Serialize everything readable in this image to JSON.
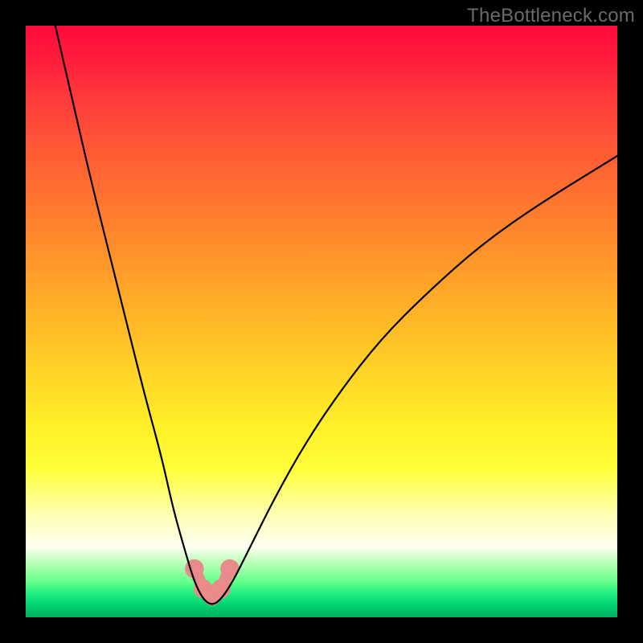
{
  "watermark": "TheBottleneck.com",
  "chart_data": {
    "type": "line",
    "title": "",
    "xlabel": "",
    "ylabel": "",
    "xlim": [
      0,
      100
    ],
    "ylim": [
      0,
      100
    ],
    "series": [
      {
        "name": "bottleneck-curve",
        "x": [
          5,
          8,
          11,
          14,
          17,
          20,
          23,
          25,
          27,
          28.5,
          30,
          31.5,
          33,
          35,
          38,
          42,
          47,
          53,
          60,
          68,
          77,
          87,
          100
        ],
        "values": [
          100,
          87,
          74,
          62,
          50,
          38,
          27,
          18,
          11,
          6,
          3,
          2,
          3,
          6,
          12,
          20,
          29,
          38,
          47,
          55,
          63,
          70,
          78
        ]
      }
    ],
    "markers": [
      {
        "name": "left-elbow",
        "cx": 28.5,
        "cy": 8.2,
        "r": 1.6
      },
      {
        "name": "bottom-left",
        "cx": 30.0,
        "cy": 4.8,
        "r": 1.6
      },
      {
        "name": "bottom-center",
        "cx": 31.5,
        "cy": 3.6,
        "r": 1.6
      },
      {
        "name": "bottom-right",
        "cx": 33.0,
        "cy": 4.8,
        "r": 1.6
      },
      {
        "name": "right-elbow",
        "cx": 34.5,
        "cy": 8.2,
        "r": 1.6
      }
    ],
    "marker_stroke": {
      "start_idx": 0,
      "end_idx": 4
    },
    "colors": {
      "curve": "#000000",
      "marker_fill": "#e98b8b",
      "marker_stroke": "#e98b8b"
    }
  }
}
